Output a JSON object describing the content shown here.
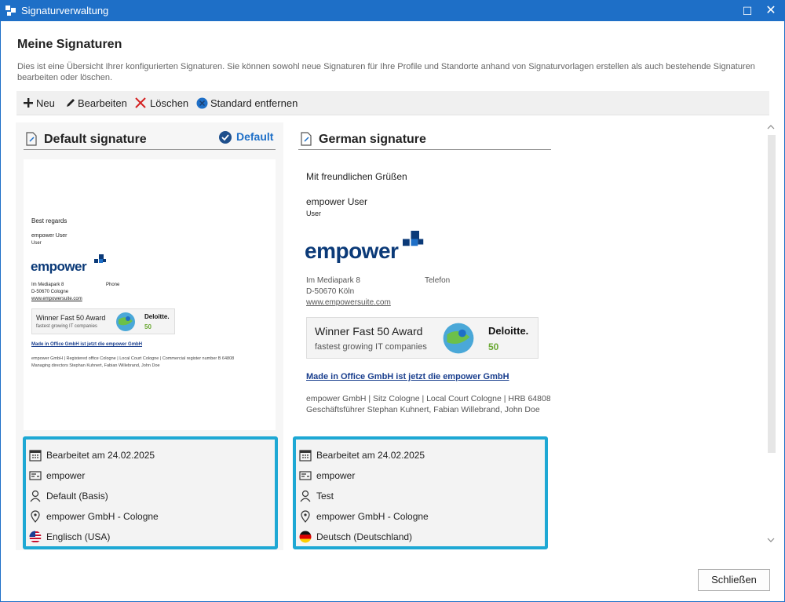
{
  "window": {
    "title": "Signaturverwaltung",
    "maximize_glyph": "☐",
    "close_glyph": "✕"
  },
  "page": {
    "heading": "Meine Signaturen",
    "description": "Dies ist eine Übersicht Ihrer konfigurierten Signaturen. Sie können sowohl neue Signaturen für Ihre Profile und Standorte anhand von Signaturvorlagen erstellen als auch bestehende Signaturen bearbeiten oder löschen."
  },
  "toolbar": {
    "new_label": "Neu",
    "edit_label": "Bearbeiten",
    "delete_label": "Löschen",
    "remove_default_label": "Standard entfernen"
  },
  "colors": {
    "accent": "#1e6fc7",
    "selection_border": "#1ea8d4",
    "logo": "#0b3a78"
  },
  "cards": [
    {
      "title": "Default signature",
      "default_label": "Default",
      "preview": {
        "greeting": "Best regards",
        "name": "empower User",
        "role": "User",
        "logo_text": "empower",
        "address1": "Im Mediapark 8",
        "address2": "D-50670 Cologne",
        "website": "www.empowersuite.com",
        "phone_label": "Phone",
        "award_title": "Winner Fast 50 Award",
        "award_subtitle": "fastest growing IT companies",
        "award_brand": "Deloitte.",
        "award_number": "50",
        "banner_link": "Made in Office GmbH ist jetzt die empower GmbH",
        "footer1": "empower GmbH | Registered office Cologne | Local Court Cologne | Commercial register number B 64808",
        "footer2": "Managing directors Stephan Kuhnert, Fabian Willebrand, John Doe"
      },
      "meta": {
        "edited": "Bearbeitet am 24.02.2025",
        "template": "empower",
        "profile": "Default (Basis)",
        "location": "empower GmbH - Cologne",
        "language": "Englisch (USA)"
      }
    },
    {
      "title": "German signature",
      "preview": {
        "greeting": "Mit freundlichen Grüßen",
        "name": "empower User",
        "role": "User",
        "logo_text": "empower",
        "address1": "Im Mediapark 8",
        "address2": "D-50670 Köln",
        "website": "www.empowersuite.com",
        "phone_label": "Telefon",
        "award_title": "Winner Fast 50 Award",
        "award_subtitle": "fastest growing IT companies",
        "award_brand": "Deloitte.",
        "award_number": "50",
        "banner_link": "Made in Office GmbH ist jetzt die empower GmbH",
        "footer1": "empower GmbH | Sitz Cologne | Local Court Cologne | HRB 64808",
        "footer2": "Geschäftsführer Stephan Kuhnert, Fabian Willebrand, John Doe"
      },
      "meta": {
        "edited": "Bearbeitet am 24.02.2025",
        "template": "empower",
        "profile": "Test",
        "location": "empower GmbH - Cologne",
        "language": "Deutsch (Deutschland)"
      }
    }
  ],
  "footer": {
    "close_label": "Schließen"
  }
}
